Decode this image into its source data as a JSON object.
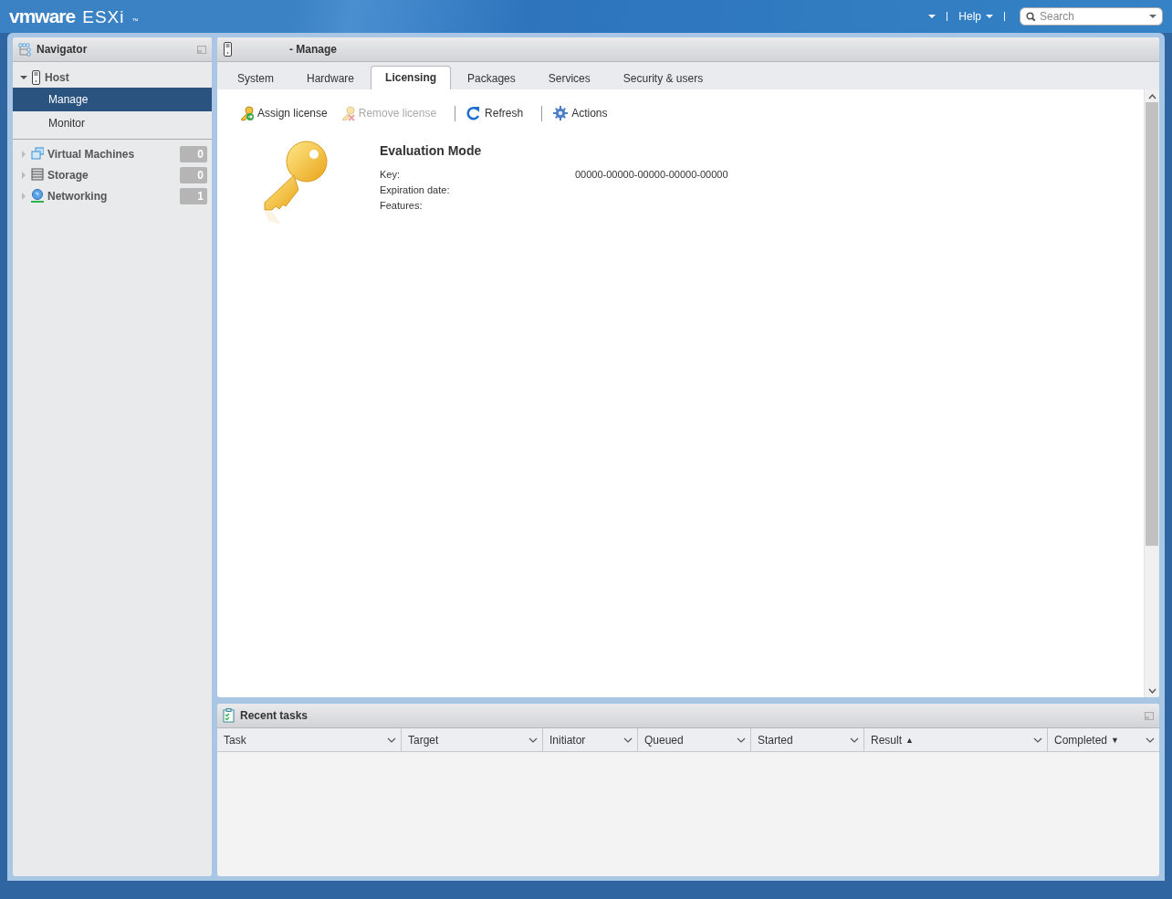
{
  "header": {
    "brand": "vmware",
    "product": "ESXi",
    "trademark": "™",
    "help": "Help",
    "search": {
      "placeholder": "Search"
    }
  },
  "navigator": {
    "title": "Navigator",
    "items": [
      {
        "label": "Host",
        "expanded": true,
        "children": [
          {
            "label": "Manage",
            "selected": true
          },
          {
            "label": "Monitor",
            "selected": false
          }
        ]
      },
      {
        "label": "Virtual Machines",
        "expanded": false,
        "count": "0",
        "kind": "vms"
      },
      {
        "label": "Storage",
        "expanded": false,
        "count": "0",
        "kind": "storage"
      },
      {
        "label": "Networking",
        "expanded": false,
        "count": "1",
        "kind": "network"
      }
    ]
  },
  "main": {
    "title": "- Manage",
    "tabs": [
      {
        "label": "System",
        "selected": false
      },
      {
        "label": "Hardware",
        "selected": false
      },
      {
        "label": "Licensing",
        "selected": true
      },
      {
        "label": "Packages",
        "selected": false
      },
      {
        "label": "Services",
        "selected": false
      },
      {
        "label": "Security & users",
        "selected": false
      }
    ],
    "toolbar": [
      {
        "label": "Assign license",
        "kind": "assign",
        "disabled": false
      },
      {
        "label": "Remove license",
        "kind": "remove",
        "disabled": true
      },
      {
        "label": "Refresh",
        "kind": "refresh",
        "disabled": false
      },
      {
        "label": "Actions",
        "kind": "actions",
        "disabled": false
      }
    ],
    "license": {
      "title": "Evaluation Mode",
      "fields": [
        {
          "label": "Key:",
          "value": "00000-00000-00000-00000-00000"
        },
        {
          "label": "Expiration date:"
        },
        {
          "label": "Features:"
        }
      ]
    }
  },
  "recent_tasks": {
    "title": "Recent tasks",
    "columns": [
      {
        "label": "Task"
      },
      {
        "label": "Target"
      },
      {
        "label": "Initiator"
      },
      {
        "label": "Queued"
      },
      {
        "label": "Started"
      },
      {
        "label": "Result",
        "sort_mark": "▲"
      },
      {
        "label": "Completed",
        "sort_mark": "▼"
      }
    ]
  }
}
